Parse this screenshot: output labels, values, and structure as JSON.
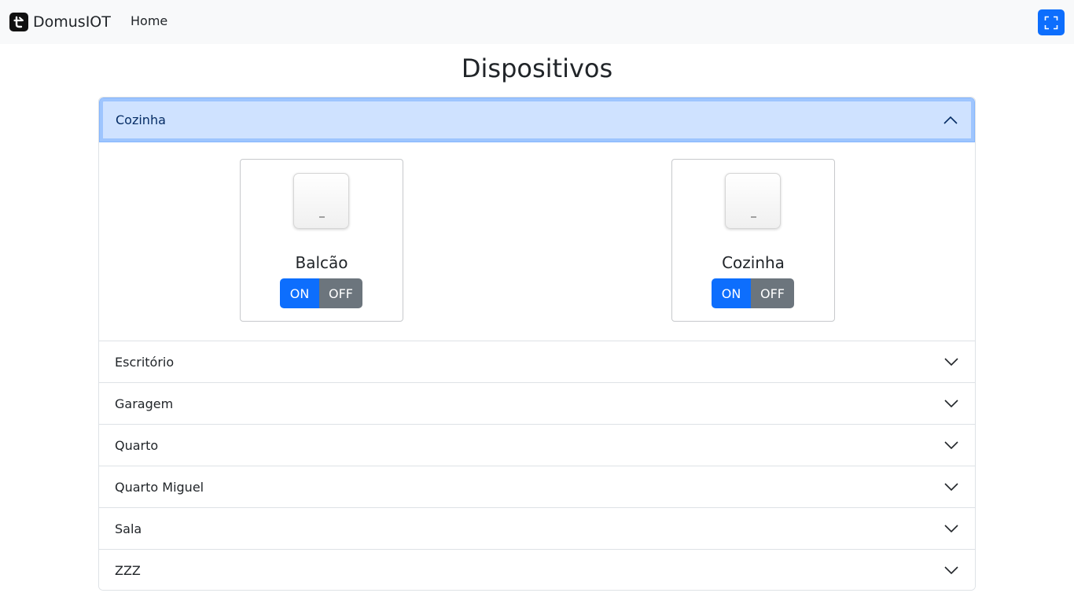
{
  "navbar": {
    "brand": "DomusIOT",
    "home": "Home",
    "logo_icon": "tuya-t-logo-icon",
    "fullscreen_icon": "fullscreen-icon"
  },
  "page": {
    "title": "Dispositivos"
  },
  "rooms": [
    {
      "name": "Cozinha",
      "expanded": true,
      "devices": [
        {
          "name": "Balcão",
          "on_label": "ON",
          "off_label": "OFF",
          "indicator": "-"
        },
        {
          "name": "Cozinha",
          "on_label": "ON",
          "off_label": "OFF",
          "indicator": "-"
        }
      ]
    },
    {
      "name": "Escritório",
      "expanded": false
    },
    {
      "name": "Garagem",
      "expanded": false
    },
    {
      "name": "Quarto",
      "expanded": false
    },
    {
      "name": "Quarto Miguel",
      "expanded": false
    },
    {
      "name": "Sala",
      "expanded": false
    },
    {
      "name": "ZZZ",
      "expanded": false
    }
  ],
  "colors": {
    "primary": "#0d6efd",
    "secondary": "#6c757d",
    "accordion_active_bg": "#cfe2ff",
    "accordion_active_text": "#052c65",
    "navbar_bg": "#f8f9fa"
  }
}
